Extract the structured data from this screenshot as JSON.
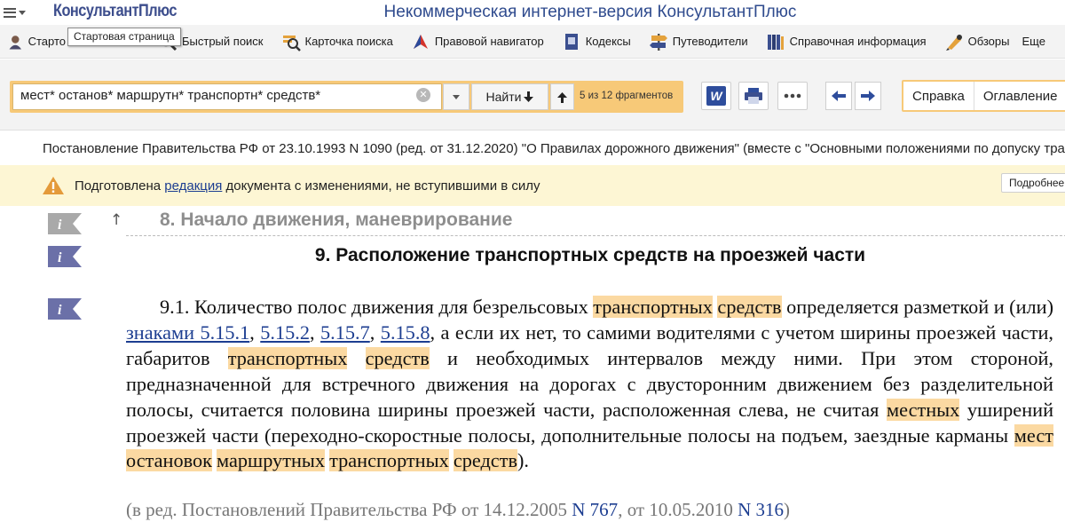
{
  "app": {
    "logo_text": "КонсультантПлюс",
    "title": "Некоммерческая интернет-версия КонсультантПлюс"
  },
  "toolbar": {
    "items": [
      {
        "label": "Стартовая страница",
        "icon": "home-icon"
      },
      {
        "label": "Быстрый поиск",
        "icon": "magnifier-icon"
      },
      {
        "label": "Карточка поиска",
        "icon": "search-card-icon"
      },
      {
        "label": "Правовой навигатор",
        "icon": "compass-icon"
      },
      {
        "label": "Кодексы",
        "icon": "codex-book-icon"
      },
      {
        "label": "Путеводители",
        "icon": "signpost-icon"
      },
      {
        "label": "Справочная информация",
        "icon": "books-icon"
      },
      {
        "label": "Обзоры",
        "icon": "pen-icon"
      },
      {
        "label": "Еще",
        "icon": ""
      }
    ],
    "start_label_visible": "Старто",
    "tooltip": "Стартовая страница"
  },
  "search": {
    "query": "мест* останов* маршрутн* транспортн* средств*",
    "find_label": "Найти",
    "fragments": "5 из 12 фрагментов",
    "accent_color": "#f7c978"
  },
  "tabs": [
    {
      "label": "Справка"
    },
    {
      "label": "Оглавление"
    }
  ],
  "document": {
    "title": "Постановление Правительства РФ от 23.10.1993 N 1090 (ред. от 31.12.2020) \"О Правилах дорожного движения\" (вместе с \"Основными положениями по допуску транспортных средств\")",
    "warning": {
      "before": "Подготовлена ",
      "link": "редакция",
      "after": " документа с изменениями, не вступившими в силу",
      "button": "Подробнее"
    },
    "prev_section": "8. Начало движения, маневрирование",
    "section_title": "9. Расположение транспортных средств на проезжей части",
    "paragraph": {
      "p01": "9.1. Количество полос движения для безрельсовых ",
      "p02": "транспортных",
      "p03": " ",
      "p04": "средств",
      "p05": " определяется разметкой и (или) ",
      "p06": "знаками 5.15.1",
      "p07": ", ",
      "p08": "5.15.2",
      "p09": ", ",
      "p10": "5.15.7",
      "p11": ", ",
      "p12": "5.15.8",
      "p13": ", а если их нет, то самими водителями с учетом ширины проезжей части, габаритов ",
      "p14": "транспортных",
      "p15": " ",
      "p16": "средств",
      "p17": " и необходимых интервалов между ними. При этом стороной, предназначенной для встречного движения на дорогах с двусторонним движением без разделительной полосы, считается половина ширины проезжей части, расположенная слева, не считая ",
      "p18": "местных",
      "p19": " уширений проезжей части (переходно-скоростные полосы, дополнительные полосы на подъем, заездные карманы ",
      "p20": "мест",
      "p21": " ",
      "p22": "остановок",
      "p23": " ",
      "p24": "маршрутных",
      "p25": " ",
      "p26": "транспортных",
      "p27": " ",
      "p28": "средств",
      "p29": ")."
    },
    "edit_note": {
      "a": "(в ред. Постановлений Правительства РФ от 14.12.2005 ",
      "b": "N 767",
      "c": ", от 10.05.2010 ",
      "d": "N 316",
      "e": ")"
    },
    "highlight_color": "#fbd9a2",
    "link_color": "#1d3e91"
  }
}
